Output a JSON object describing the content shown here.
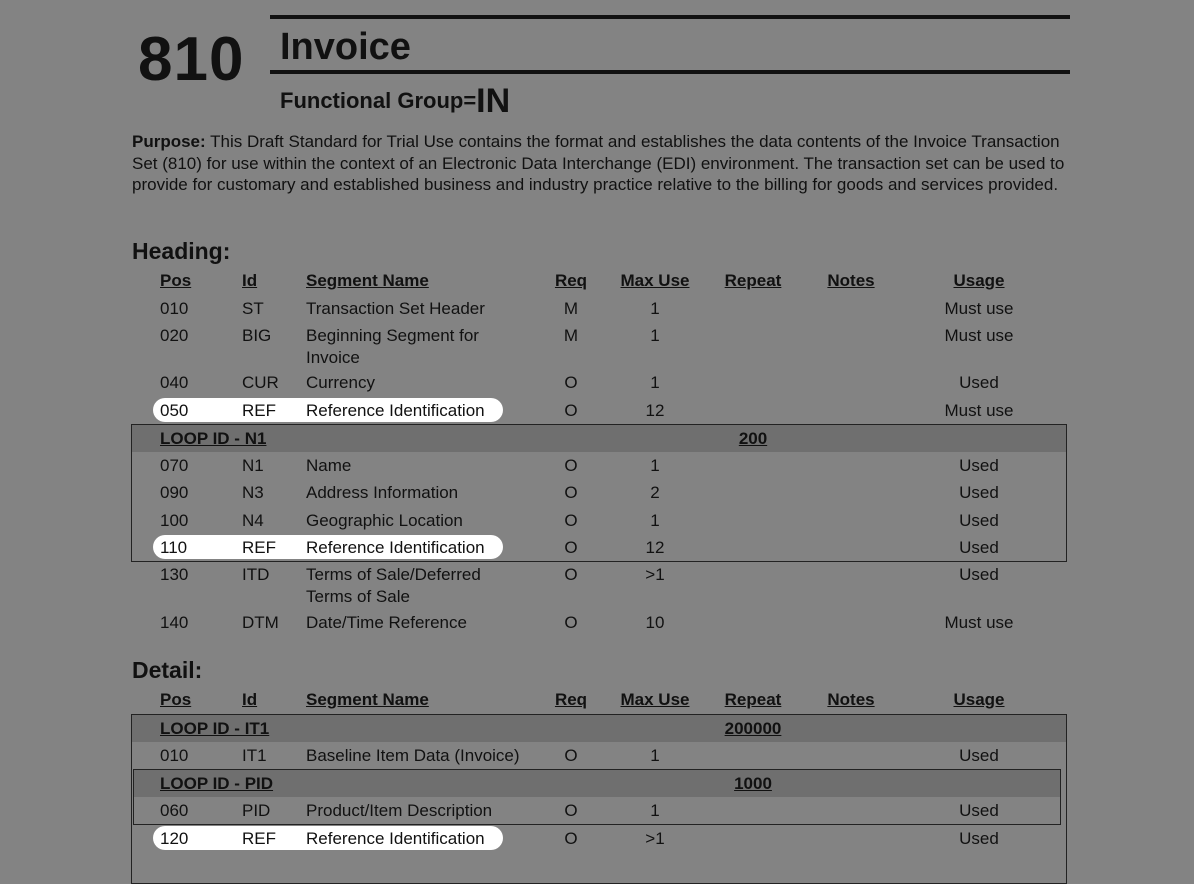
{
  "doc": {
    "txset": "810",
    "txname": "Invoice",
    "fg_label": "Functional Group=",
    "fg_value": "IN",
    "purpose_label": "Purpose:",
    "purpose_text": " This Draft Standard for Trial Use contains the format and establishes the data contents of the Invoice Transaction Set (810) for use within the context of an Electronic Data Interchange (EDI) environment. The transaction set can be used to provide for customary and established business and industry practice relative to the billing for goods and services provided."
  },
  "columns": {
    "pos": "Pos",
    "id": "Id",
    "name": "Segment Name",
    "req": "Req",
    "max": "Max Use",
    "repeat": "Repeat",
    "notes": "Notes",
    "usage": "Usage"
  },
  "heading": {
    "title": "Heading:",
    "rows": [
      {
        "pos": "010",
        "id": "ST",
        "name": "Transaction Set Header",
        "req": "M",
        "max": "1",
        "usage": "Must use"
      },
      {
        "pos": "020",
        "id": "BIG",
        "name": "Beginning Segment for Invoice",
        "req": "M",
        "max": "1",
        "usage": "Must use"
      },
      {
        "pos": "040",
        "id": "CUR",
        "name": "Currency",
        "req": "O",
        "max": "1",
        "usage": "Used"
      },
      {
        "pos": "050",
        "id": "REF",
        "name": "Reference Identification",
        "req": "O",
        "max": "12",
        "usage": "Must use",
        "highlight": true
      },
      {
        "pos": "070",
        "id": "N1",
        "name": "Name",
        "req": "O",
        "max": "1",
        "usage": "Used"
      },
      {
        "pos": "090",
        "id": "N3",
        "name": "Address Information",
        "req": "O",
        "max": "2",
        "usage": "Used"
      },
      {
        "pos": "100",
        "id": "N4",
        "name": "Geographic Location",
        "req": "O",
        "max": "1",
        "usage": "Used"
      },
      {
        "pos": "110",
        "id": "REF",
        "name": "Reference Identification",
        "req": "O",
        "max": "12",
        "usage": "Used",
        "highlight": true
      },
      {
        "pos": "130",
        "id": "ITD",
        "name": "Terms of Sale/Deferred Terms of Sale",
        "req": "O",
        "max": ">1",
        "usage": "Used"
      },
      {
        "pos": "140",
        "id": "DTM",
        "name": "Date/Time Reference",
        "req": "O",
        "max": "10",
        "usage": "Must use"
      }
    ],
    "loop_n1": {
      "label": "LOOP ID - N1",
      "repeat": "200"
    }
  },
  "detail": {
    "title": "Detail:",
    "loop_it1": {
      "label": "LOOP ID - IT1",
      "repeat": "200000"
    },
    "loop_pid": {
      "label": "LOOP ID - PID",
      "repeat": "1000"
    },
    "rows": [
      {
        "pos": "010",
        "id": "IT1",
        "name": "Baseline Item Data (Invoice)",
        "req": "O",
        "max": "1",
        "usage": "Used"
      },
      {
        "pos": "060",
        "id": "PID",
        "name": "Product/Item Description",
        "req": "O",
        "max": "1",
        "usage": "Used"
      },
      {
        "pos": "120",
        "id": "REF",
        "name": "Reference Identification",
        "req": "O",
        "max": ">1",
        "usage": "Used",
        "highlight": true
      }
    ]
  }
}
